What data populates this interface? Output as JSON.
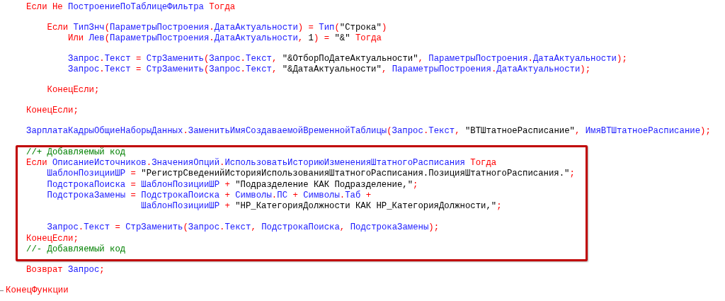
{
  "blocks": [
    {
      "kind": "plain",
      "lines": [
        {
          "kind": "code",
          "tokens": [
            {
              "kind": "keyword",
              "text": "Если Не "
            },
            {
              "kind": "name",
              "text": "ПостроениеПоТаблицеФильтра"
            },
            {
              "kind": "keyword",
              "text": " Тогда"
            }
          ]
        },
        {
          "kind": "blank"
        },
        {
          "kind": "code",
          "tokens": [
            {
              "kind": "keyword",
              "text": "    Если "
            },
            {
              "kind": "name",
              "text": "ТипЗнч"
            },
            {
              "kind": "op",
              "text": "("
            },
            {
              "kind": "name",
              "text": "ПараметрыПостроения"
            },
            {
              "kind": "op",
              "text": "."
            },
            {
              "kind": "name",
              "text": "ДатаАктуальности"
            },
            {
              "kind": "op",
              "text": ") = "
            },
            {
              "kind": "name",
              "text": "Тип"
            },
            {
              "kind": "op",
              "text": "("
            },
            {
              "kind": "string",
              "text": "\"Строка\""
            },
            {
              "kind": "op",
              "text": ")"
            }
          ]
        },
        {
          "kind": "code",
          "tokens": [
            {
              "kind": "keyword",
              "text": "        Или "
            },
            {
              "kind": "name",
              "text": "Лев"
            },
            {
              "kind": "op",
              "text": "("
            },
            {
              "kind": "name",
              "text": "ПараметрыПостроения"
            },
            {
              "kind": "op",
              "text": "."
            },
            {
              "kind": "name",
              "text": "ДатаАктуальности"
            },
            {
              "kind": "op",
              "text": ", "
            },
            {
              "kind": "string",
              "text": "1"
            },
            {
              "kind": "op",
              "text": ") = "
            },
            {
              "kind": "string",
              "text": "\"&\""
            },
            {
              "kind": "keyword",
              "text": " Тогда"
            }
          ]
        },
        {
          "kind": "blank"
        },
        {
          "kind": "code",
          "tokens": [
            {
              "kind": "name",
              "text": "        Запрос"
            },
            {
              "kind": "op",
              "text": "."
            },
            {
              "kind": "name",
              "text": "Текст"
            },
            {
              "kind": "op",
              "text": " = "
            },
            {
              "kind": "name",
              "text": "СтрЗаменить"
            },
            {
              "kind": "op",
              "text": "("
            },
            {
              "kind": "name",
              "text": "Запрос"
            },
            {
              "kind": "op",
              "text": "."
            },
            {
              "kind": "name",
              "text": "Текст"
            },
            {
              "kind": "op",
              "text": ", "
            },
            {
              "kind": "string",
              "text": "\"&ОтборПоДатеАктуальности\""
            },
            {
              "kind": "op",
              "text": ", "
            },
            {
              "kind": "name",
              "text": "ПараметрыПостроения"
            },
            {
              "kind": "op",
              "text": "."
            },
            {
              "kind": "name",
              "text": "ДатаАктуальности"
            },
            {
              "kind": "op",
              "text": ");"
            }
          ]
        },
        {
          "kind": "code",
          "tokens": [
            {
              "kind": "name",
              "text": "        Запрос"
            },
            {
              "kind": "op",
              "text": "."
            },
            {
              "kind": "name",
              "text": "Текст"
            },
            {
              "kind": "op",
              "text": " = "
            },
            {
              "kind": "name",
              "text": "СтрЗаменить"
            },
            {
              "kind": "op",
              "text": "("
            },
            {
              "kind": "name",
              "text": "Запрос"
            },
            {
              "kind": "op",
              "text": "."
            },
            {
              "kind": "name",
              "text": "Текст"
            },
            {
              "kind": "op",
              "text": ", "
            },
            {
              "kind": "string",
              "text": "\"&ДатаАктуальности\""
            },
            {
              "kind": "op",
              "text": ", "
            },
            {
              "kind": "name",
              "text": "ПараметрыПостроения"
            },
            {
              "kind": "op",
              "text": "."
            },
            {
              "kind": "name",
              "text": "ДатаАктуальности"
            },
            {
              "kind": "op",
              "text": ");"
            }
          ]
        },
        {
          "kind": "blank"
        },
        {
          "kind": "code",
          "tokens": [
            {
              "kind": "keyword",
              "text": "    КонецЕсли;"
            }
          ]
        },
        {
          "kind": "blank"
        },
        {
          "kind": "code",
          "tokens": [
            {
              "kind": "keyword",
              "text": "КонецЕсли;"
            }
          ]
        },
        {
          "kind": "blank"
        },
        {
          "kind": "code",
          "tokens": [
            {
              "kind": "name",
              "text": "ЗарплатаКадрыОбщиеНаборыДанных"
            },
            {
              "kind": "op",
              "text": "."
            },
            {
              "kind": "name",
              "text": "ЗаменитьИмяСоздаваемойВременнойТаблицы"
            },
            {
              "kind": "op",
              "text": "("
            },
            {
              "kind": "name",
              "text": "Запрос"
            },
            {
              "kind": "op",
              "text": "."
            },
            {
              "kind": "name",
              "text": "Текст"
            },
            {
              "kind": "op",
              "text": ", "
            },
            {
              "kind": "string",
              "text": "\"ВТШтатноеРасписание\""
            },
            {
              "kind": "op",
              "text": ", "
            },
            {
              "kind": "name",
              "text": "ИмяВТШтатноеРасписание"
            },
            {
              "kind": "op",
              "text": ");"
            }
          ]
        }
      ]
    },
    {
      "kind": "highlight",
      "lines": [
        {
          "kind": "code",
          "tokens": [
            {
              "kind": "comment",
              "text": "//+ Добавляемый код"
            }
          ]
        },
        {
          "kind": "code",
          "tokens": [
            {
              "kind": "keyword",
              "text": "Если "
            },
            {
              "kind": "name",
              "text": "ОписаниеИсточников"
            },
            {
              "kind": "op",
              "text": "."
            },
            {
              "kind": "name",
              "text": "ЗначенияОпций"
            },
            {
              "kind": "op",
              "text": "."
            },
            {
              "kind": "name",
              "text": "ИспользоватьИсториюИзмененияШтатногоРасписания"
            },
            {
              "kind": "keyword",
              "text": " Тогда"
            }
          ]
        },
        {
          "kind": "code",
          "tokens": [
            {
              "kind": "name",
              "text": "    ШаблонПозицииШР"
            },
            {
              "kind": "op",
              "text": " = "
            },
            {
              "kind": "string",
              "text": "\"РегистрСведенийИсторияИспользованияШтатногоРасписания.ПозицияШтатногоРасписания.\""
            },
            {
              "kind": "op",
              "text": ";"
            }
          ]
        },
        {
          "kind": "code",
          "tokens": [
            {
              "kind": "name",
              "text": "    ПодстрокаПоиска"
            },
            {
              "kind": "op",
              "text": " = "
            },
            {
              "kind": "name",
              "text": "ШаблонПозицииШР"
            },
            {
              "kind": "op",
              "text": " + "
            },
            {
              "kind": "string",
              "text": "\"Подразделение КАК Подразделение,\""
            },
            {
              "kind": "op",
              "text": ";"
            }
          ]
        },
        {
          "kind": "code",
          "tokens": [
            {
              "kind": "name",
              "text": "    ПодстрокаЗамены"
            },
            {
              "kind": "op",
              "text": " = "
            },
            {
              "kind": "name",
              "text": "ПодстрокаПоиска"
            },
            {
              "kind": "op",
              "text": " + "
            },
            {
              "kind": "name",
              "text": "Символы"
            },
            {
              "kind": "op",
              "text": "."
            },
            {
              "kind": "name",
              "text": "ПС"
            },
            {
              "kind": "op",
              "text": " + "
            },
            {
              "kind": "name",
              "text": "Символы"
            },
            {
              "kind": "op",
              "text": "."
            },
            {
              "kind": "name",
              "text": "Таб"
            },
            {
              "kind": "op",
              "text": " +"
            }
          ]
        },
        {
          "kind": "code",
          "tokens": [
            {
              "kind": "name",
              "text": "                      ШаблонПозицииШР"
            },
            {
              "kind": "op",
              "text": " + "
            },
            {
              "kind": "string",
              "text": "\"НР_КатегорияДолжности КАК НР_КатегорияДолжности,\""
            },
            {
              "kind": "op",
              "text": ";"
            }
          ]
        },
        {
          "kind": "blank"
        },
        {
          "kind": "code",
          "tokens": [
            {
              "kind": "name",
              "text": "    Запрос"
            },
            {
              "kind": "op",
              "text": "."
            },
            {
              "kind": "name",
              "text": "Текст"
            },
            {
              "kind": "op",
              "text": " = "
            },
            {
              "kind": "name",
              "text": "СтрЗаменить"
            },
            {
              "kind": "op",
              "text": "("
            },
            {
              "kind": "name",
              "text": "Запрос"
            },
            {
              "kind": "op",
              "text": "."
            },
            {
              "kind": "name",
              "text": "Текст"
            },
            {
              "kind": "op",
              "text": ", "
            },
            {
              "kind": "name",
              "text": "ПодстрокаПоиска"
            },
            {
              "kind": "op",
              "text": ", "
            },
            {
              "kind": "name",
              "text": "ПодстрокаЗамены"
            },
            {
              "kind": "op",
              "text": ");"
            }
          ]
        },
        {
          "kind": "code",
          "tokens": [
            {
              "kind": "keyword",
              "text": "КонецЕсли;"
            }
          ]
        },
        {
          "kind": "code",
          "tokens": [
            {
              "kind": "comment",
              "text": "//- Добавляемый код"
            }
          ]
        }
      ]
    },
    {
      "kind": "plain",
      "lines": [
        {
          "kind": "code",
          "tokens": [
            {
              "kind": "keyword",
              "text": "Возврат "
            },
            {
              "kind": "name",
              "text": "Запрос"
            },
            {
              "kind": "op",
              "text": ";"
            }
          ]
        },
        {
          "kind": "blank"
        },
        {
          "kind": "fold",
          "tokens": [
            {
              "kind": "keyword",
              "text": "КонецФункции"
            }
          ]
        }
      ]
    }
  ]
}
